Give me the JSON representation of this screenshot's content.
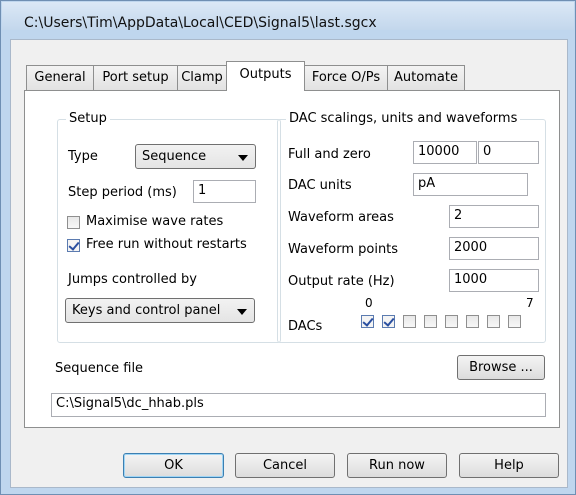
{
  "window": {
    "title": "C:\\Users\\Tim\\AppData\\Local\\CED\\Signal5\\last.sgcx"
  },
  "tabs": [
    {
      "label": "General"
    },
    {
      "label": "Port setup"
    },
    {
      "label": "Clamp"
    },
    {
      "label": "Outputs",
      "active": true
    },
    {
      "label": "Force O/Ps"
    },
    {
      "label": "Automate"
    }
  ],
  "setup": {
    "title": "Setup",
    "type_label": "Type",
    "type_value": "Sequence",
    "step_period_label": "Step period (ms)",
    "step_period_value": "1",
    "maximise_label": "Maximise wave rates",
    "maximise_checked": false,
    "freerun_label": "Free run without restarts",
    "freerun_checked": true,
    "jumps_label": "Jumps controlled by",
    "jumps_value": "Keys and control panel"
  },
  "dac": {
    "title": "DAC scalings, units and waveforms",
    "full_zero_label": "Full and zero",
    "full_value": "10000",
    "zero_value": "0",
    "units_label": "DAC units",
    "units_value": "pA",
    "areas_label": "Waveform areas",
    "areas_value": "2",
    "points_label": "Waveform points",
    "points_value": "2000",
    "rate_label": "Output rate (Hz)",
    "rate_value": "1000",
    "dacs_label": "DACs",
    "dac_first_index": "0",
    "dac_last_index": "7",
    "dac_checked": [
      true,
      true,
      false,
      false,
      false,
      false,
      false,
      false
    ]
  },
  "sequence": {
    "label": "Sequence file",
    "browse_label": "Browse ...",
    "file_value": "C:\\Signal5\\dc_hhab.pls"
  },
  "buttons": {
    "ok": "OK",
    "cancel": "Cancel",
    "run_now": "Run now",
    "help": "Help"
  },
  "colors": {
    "frame": "#bfd6ee",
    "client": "#f0f0f0",
    "page": "#ffffff",
    "check_accent": "#2a4fa0"
  }
}
